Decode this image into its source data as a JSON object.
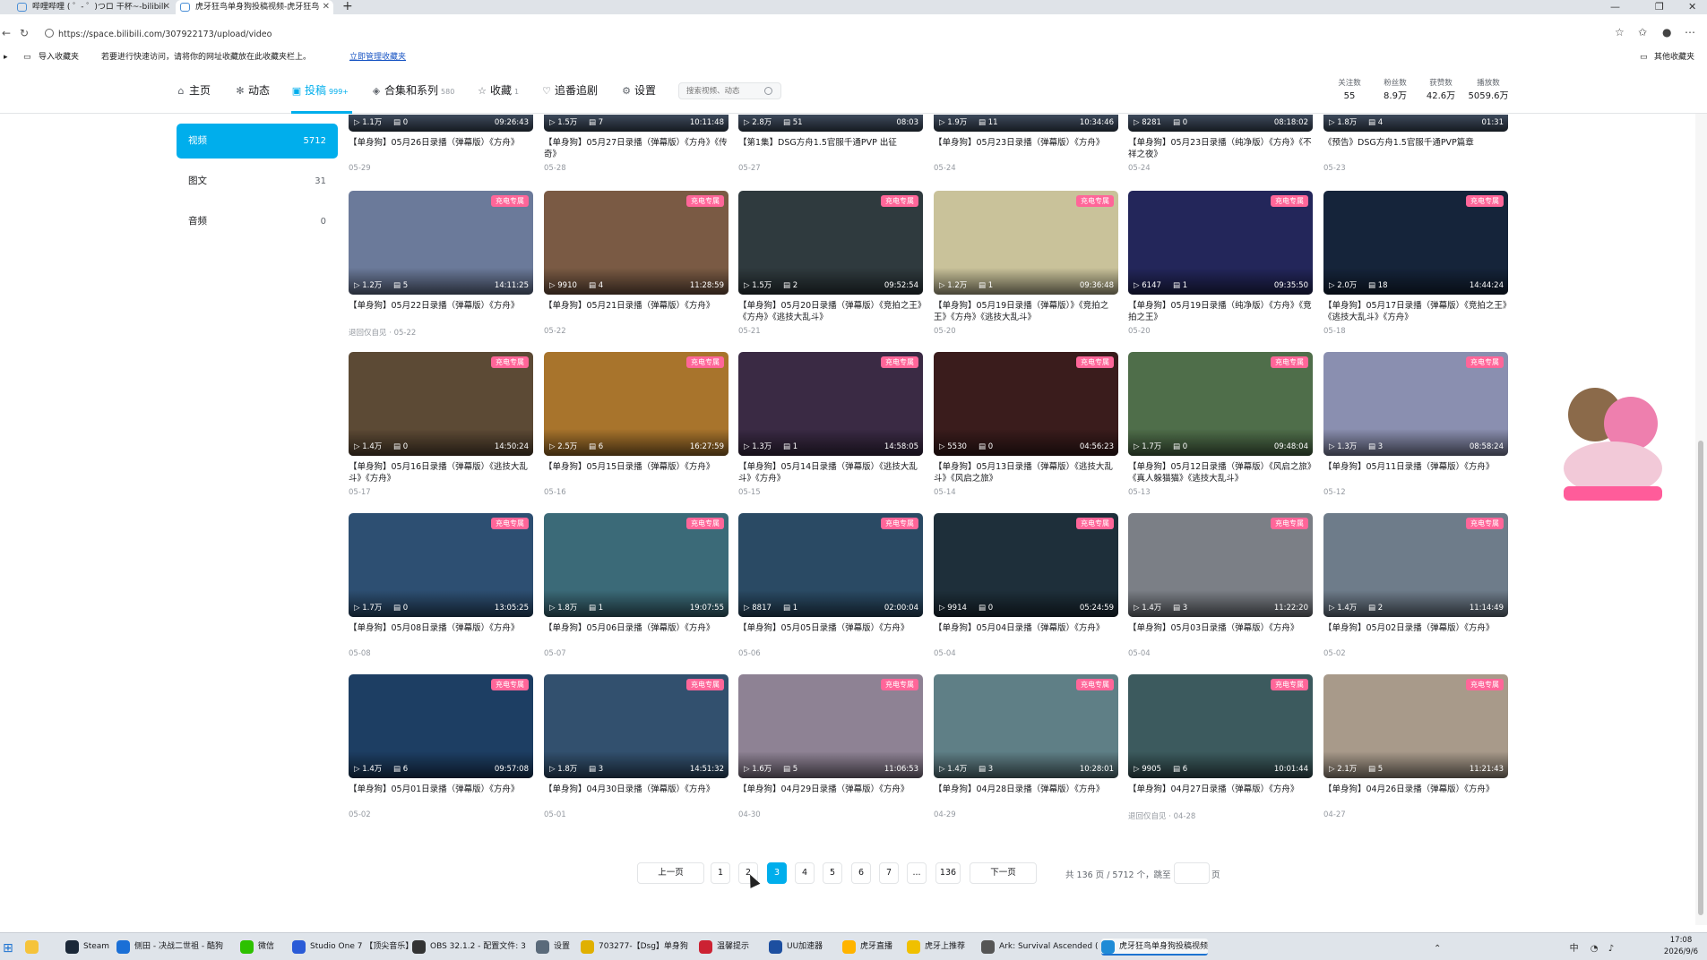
{
  "browser": {
    "tabs": [
      {
        "title": "哔哩哔哩 ( ゜- ゜)つロ 干杯~-bilibili"
      },
      {
        "title": "虎牙狂鸟单身狗投稿视频-虎牙狂鸟"
      }
    ],
    "url": "https://space.bilibili.com/307922173/upload/video",
    "bookmarks": {
      "import": "导入收藏夹",
      "hint": "若要进行快速访问，请将你的网址收藏放在此收藏夹栏上。",
      "manage": "立即管理收藏夹",
      "other": "其他收藏夹"
    }
  },
  "nav": {
    "home": "主页",
    "dynamic": "动态",
    "upload": "投稿",
    "upload_count": "999+",
    "collections": "合集和系列",
    "collections_count": "580",
    "favorites": "收藏",
    "favorites_count": "1",
    "follow": "追番追剧",
    "settings": "设置",
    "search_placeholder": "搜索视频、动态"
  },
  "stats": [
    {
      "label": "关注数",
      "value": "55"
    },
    {
      "label": "粉丝数",
      "value": "8.9万"
    },
    {
      "label": "获赞数",
      "value": "42.6万"
    },
    {
      "label": "播放数",
      "value": "5059.6万"
    }
  ],
  "sidebar": [
    {
      "label": "视频",
      "count": "5712"
    },
    {
      "label": "图文",
      "count": "31"
    },
    {
      "label": "音频",
      "count": "0"
    }
  ],
  "badge_label": "充电专属",
  "videos": [
    {
      "plays": "1.1万",
      "danmaku": "0",
      "duration": "09:26:43",
      "title": "【单身狗】05月26日录播（弹幕版）《方舟》",
      "date": "05-29",
      "badge": false
    },
    {
      "plays": "1.5万",
      "danmaku": "7",
      "duration": "10:11:48",
      "title": "【单身狗】05月27日录播（弹幕版）《方舟》《传奇》",
      "date": "05-28",
      "badge": false
    },
    {
      "plays": "2.8万",
      "danmaku": "51",
      "duration": "08:03",
      "title": "【第1集】DSG方舟1.5官服千通PVP 出征",
      "date": "05-27",
      "badge": false
    },
    {
      "plays": "1.9万",
      "danmaku": "11",
      "duration": "10:34:46",
      "title": "【单身狗】05月23日录播（弹幕版）《方舟》",
      "date": "05-24",
      "badge": false
    },
    {
      "plays": "8281",
      "danmaku": "0",
      "duration": "08:18:02",
      "title": "【单身狗】05月23日录播（纯净版）《方舟》《不祥之夜》",
      "date": "05-24",
      "badge": false
    },
    {
      "plays": "1.8万",
      "danmaku": "4",
      "duration": "01:31",
      "title": "《预告》DSG方舟1.5官服千通PVP篇章",
      "date": "05-23",
      "badge": false
    },
    {
      "plays": "1.2万",
      "danmaku": "5",
      "duration": "14:11:25",
      "title": "【单身狗】05月22日录播（弹幕版）《方舟》",
      "date": "05-22",
      "date_prefix": "退回仅自见 ·",
      "badge": true,
      "color": "#6b7a9a"
    },
    {
      "plays": "9910",
      "danmaku": "4",
      "duration": "11:28:59",
      "title": "【单身狗】05月21日录播（弹幕版）《方舟》",
      "date": "05-22",
      "badge": true,
      "color": "#7a5a44"
    },
    {
      "plays": "1.5万",
      "danmaku": "2",
      "duration": "09:52:54",
      "title": "【单身狗】05月20日录播（弹幕版）《竞拍之王》《方舟》《逃技大乱斗》",
      "date": "05-21",
      "badge": true,
      "color": "#2f3a3e"
    },
    {
      "plays": "1.2万",
      "danmaku": "1",
      "duration": "09:36:48",
      "title": "【单身狗】05月19日录播（弹幕版）》《竞拍之王》《方舟》《逃技大乱斗》",
      "date": "05-20",
      "badge": true,
      "color": "#c9c29a"
    },
    {
      "plays": "6147",
      "danmaku": "1",
      "duration": "09:35:50",
      "title": "【单身狗】05月19日录播（纯净版）《方舟》《竞拍之王》",
      "date": "05-20",
      "badge": true,
      "color": "#23265a"
    },
    {
      "plays": "2.0万",
      "danmaku": "18",
      "duration": "14:44:24",
      "title": "【单身狗】05月17日录播（弹幕版）《竞拍之王》《逃技大乱斗》《方舟》",
      "date": "05-18",
      "badge": true,
      "color": "#15243a"
    },
    {
      "plays": "1.4万",
      "danmaku": "0",
      "duration": "14:50:24",
      "title": "【单身狗】05月16日录播（弹幕版）《逃技大乱斗》《方舟》",
      "date": "05-17",
      "badge": true,
      "color": "#5c4a35"
    },
    {
      "plays": "2.5万",
      "danmaku": "6",
      "duration": "16:27:59",
      "title": "【单身狗】05月15日录播（弹幕版）《方舟》",
      "date": "05-16",
      "badge": true,
      "color": "#a8742c"
    },
    {
      "plays": "1.3万",
      "danmaku": "1",
      "duration": "14:58:05",
      "title": "【单身狗】05月14日录播（弹幕版）《逃技大乱斗》《方舟》",
      "date": "05-15",
      "badge": true,
      "color": "#3a2a44"
    },
    {
      "plays": "5530",
      "danmaku": "0",
      "duration": "04:56:23",
      "title": "【单身狗】05月13日录播（弹幕版）《逃技大乱斗》《风启之旅》",
      "date": "05-14",
      "badge": true,
      "color": "#3a1c1c"
    },
    {
      "plays": "1.7万",
      "danmaku": "0",
      "duration": "09:48:04",
      "title": "【单身狗】05月12日录播（弹幕版）《风启之旅》《真人躲猫猫》《逃技大乱斗》",
      "date": "05-13",
      "badge": true,
      "color": "#4f6e4a"
    },
    {
      "plays": "1.3万",
      "danmaku": "3",
      "duration": "08:58:24",
      "title": "【单身狗】05月11日录播（弹幕版）《方舟》",
      "date": "05-12",
      "badge": true,
      "color": "#8a8fb0"
    },
    {
      "plays": "1.7万",
      "danmaku": "0",
      "duration": "13:05:25",
      "title": "【单身狗】05月08日录播（弹幕版）《方舟》",
      "date": "05-08",
      "badge": true,
      "color": "#2d4f72"
    },
    {
      "plays": "1.8万",
      "danmaku": "1",
      "duration": "19:07:55",
      "title": "【单身狗】05月06日录播（弹幕版）《方舟》",
      "date": "05-07",
      "badge": true,
      "color": "#3b6a78"
    },
    {
      "plays": "8817",
      "danmaku": "1",
      "duration": "02:00:04",
      "title": "【单身狗】05月05日录播（弹幕版）《方舟》",
      "date": "05-06",
      "badge": true,
      "color": "#2a4a64"
    },
    {
      "plays": "9914",
      "danmaku": "0",
      "duration": "05:24:59",
      "title": "【单身狗】05月04日录播（弹幕版）《方舟》",
      "date": "05-04",
      "badge": true,
      "color": "#1e2f3a"
    },
    {
      "plays": "1.4万",
      "danmaku": "3",
      "duration": "11:22:20",
      "title": "【单身狗】05月03日录播（弹幕版）《方舟》",
      "date": "05-04",
      "badge": true,
      "color": "#7b7f86"
    },
    {
      "plays": "1.4万",
      "danmaku": "2",
      "duration": "11:14:49",
      "title": "【单身狗】05月02日录播（弹幕版）《方舟》",
      "date": "05-02",
      "badge": true,
      "color": "#6e7c8a"
    },
    {
      "plays": "1.4万",
      "danmaku": "6",
      "duration": "09:57:08",
      "title": "【单身狗】05月01日录播（弹幕版）《方舟》",
      "date": "05-02",
      "badge": true,
      "color": "#1d3e63"
    },
    {
      "plays": "1.8万",
      "danmaku": "3",
      "duration": "14:51:32",
      "title": "【单身狗】04月30日录播（弹幕版）《方舟》",
      "date": "05-01",
      "badge": true,
      "color": "#32506e"
    },
    {
      "plays": "1.6万",
      "danmaku": "5",
      "duration": "11:06:53",
      "title": "【单身狗】04月29日录播（弹幕版）《方舟》",
      "date": "04-30",
      "badge": true,
      "color": "#8e8294"
    },
    {
      "plays": "1.4万",
      "danmaku": "3",
      "duration": "10:28:01",
      "title": "【单身狗】04月28日录播（弹幕版）《方舟》",
      "date": "04-29",
      "badge": true,
      "color": "#5f7f86"
    },
    {
      "plays": "9905",
      "danmaku": "6",
      "duration": "10:01:44",
      "title": "【单身狗】04月27日录播（弹幕版）《方舟》",
      "date": "04-28",
      "date_prefix": "退回仅自见 ·",
      "badge": true,
      "color": "#3c5a5e"
    },
    {
      "plays": "2.1万",
      "danmaku": "5",
      "duration": "11:21:43",
      "title": "【单身狗】04月26日录播（弹幕版）《方舟》",
      "date": "04-27",
      "badge": true,
      "color": "#a89a8a"
    }
  ],
  "pagination": {
    "prev": "上一页",
    "next": "下一页",
    "pages": [
      "1",
      "2",
      "3",
      "4",
      "5",
      "6",
      "7",
      "...",
      "136"
    ],
    "current": "3",
    "info": "共 136 页 / 5712 个，跳至",
    "suffix": "页"
  },
  "taskbar": {
    "apps": [
      {
        "label": "",
        "color": "#f5c33b"
      },
      {
        "label": "Steam",
        "color": "#1b2838"
      },
      {
        "label": "侧田 - 决战二世祖 - 酷狗",
        "color": "#1a6fd6"
      },
      {
        "label": "微信",
        "color": "#2dc100"
      },
      {
        "label": "Studio One 7 【顶尖音乐】",
        "color": "#2a5bd7"
      },
      {
        "label": "OBS 32.1.2 - 配置文件: 3",
        "color": "#333333"
      },
      {
        "label": "设置",
        "color": "#5a6a7a"
      },
      {
        "label": "703277-【Dsg】单身狗",
        "color": "#e0b000"
      },
      {
        "label": "温馨提示",
        "color": "#cc2233"
      },
      {
        "label": "UU加速器",
        "color": "#1d4fa0"
      },
      {
        "label": "虎牙直播",
        "color": "#ffb400"
      },
      {
        "label": "虎牙上推荐",
        "color": "#f0c000"
      },
      {
        "label": "Ark: Survival Ascended (",
        "color": "#555555"
      },
      {
        "label": "虎牙狂鸟单身狗投稿视频",
        "color": "#1f8bd6"
      }
    ],
    "time": "17:08",
    "date": "2026/9/6",
    "ime": "中"
  },
  "colors": {
    "accent": "#00aeec",
    "badge": "#ff6699",
    "card_default": "#3d4a5c"
  }
}
